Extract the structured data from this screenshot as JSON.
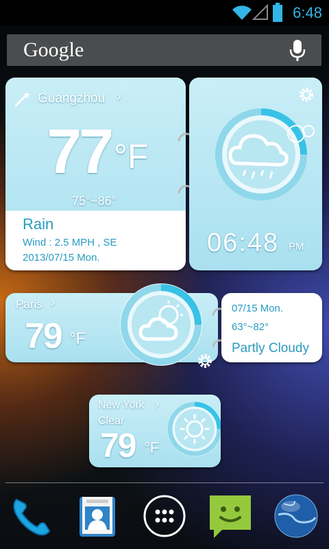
{
  "status_bar": {
    "time": "6:48"
  },
  "search": {
    "label": "Google"
  },
  "widget_main": {
    "city": "Guangzhou",
    "temp": "77",
    "unit": "°F",
    "range": "75°~86°",
    "condition": "Rain",
    "wind": "Wind : 2.5 MPH , SE",
    "date": "2013/07/15  Mon.",
    "clock": "06:48",
    "ampm": "PM"
  },
  "widget_paris": {
    "city": "Paris",
    "temp": "79",
    "unit": "°F",
    "date": "07/15 Mon.",
    "range": "63°~82°",
    "condition": "Partly Cloudy"
  },
  "widget_ny": {
    "city": "New York",
    "condition": "Clear",
    "temp": "79",
    "unit": "°F"
  },
  "dock": {
    "items": [
      "phone-icon",
      "contacts-icon",
      "app-drawer-icon",
      "messaging-icon",
      "browser-icon"
    ]
  },
  "colors": {
    "accent": "#33b5e5",
    "card": "#b5e6f2",
    "dark_text": "#2a9cc0"
  }
}
